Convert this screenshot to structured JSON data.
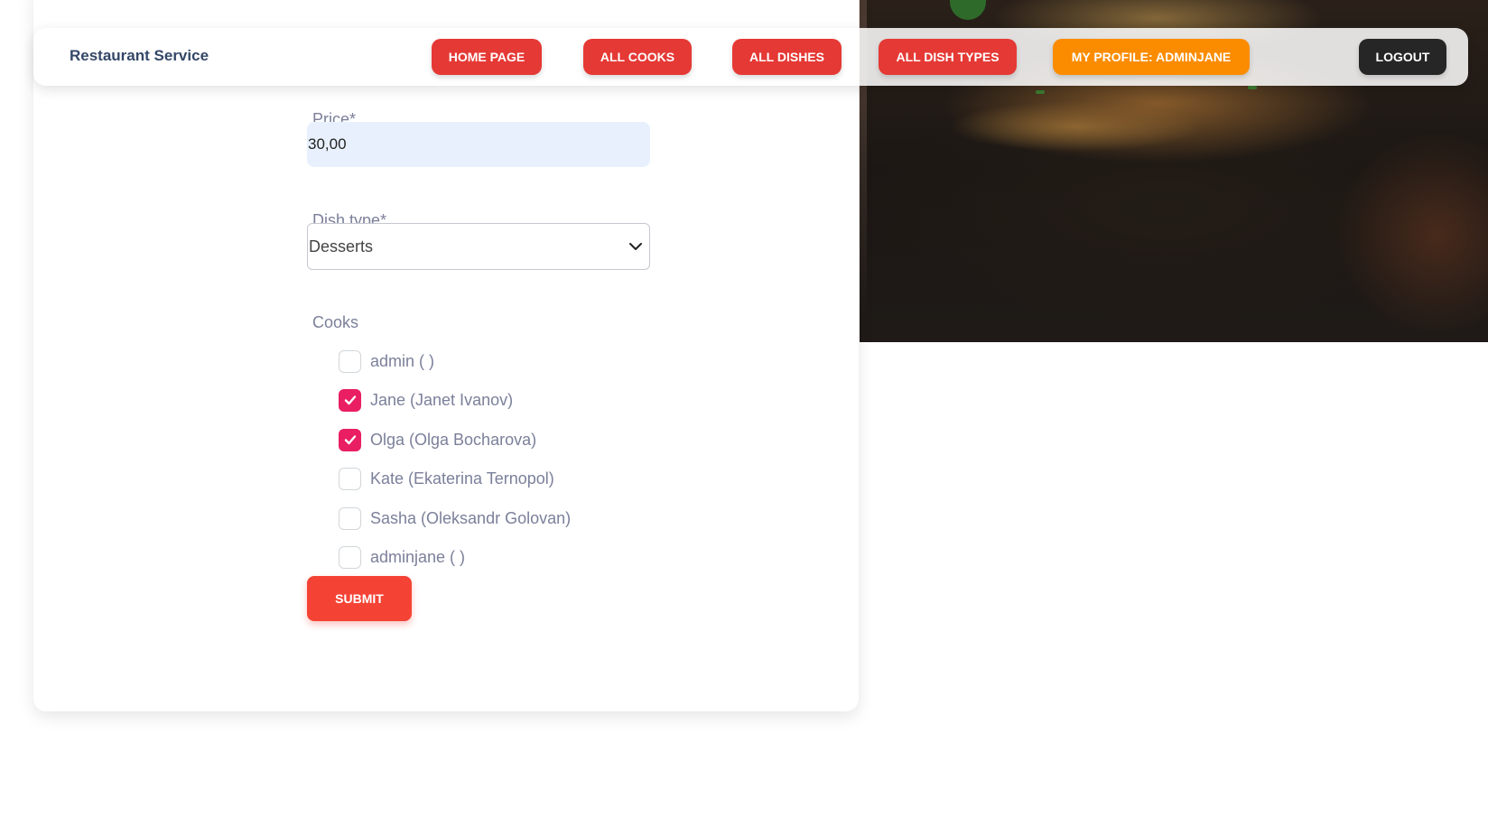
{
  "navbar": {
    "brand": "Restaurant Service",
    "buttons": [
      {
        "label": "HOME PAGE",
        "color": "#e53935"
      },
      {
        "label": "ALL COOKS",
        "color": "#e53935"
      },
      {
        "label": "ALL DISHES",
        "color": "#e53935"
      },
      {
        "label": "ALL DISH TYPES",
        "color": "#e53935"
      },
      {
        "label": "MY PROFILE: ADMINJANE",
        "color": "#fb8c00"
      },
      {
        "label": "LOGOUT",
        "color": "#262626"
      }
    ]
  },
  "form": {
    "price": {
      "label": "Price*",
      "value": "30,00"
    },
    "dish_type": {
      "label": "Dish type*",
      "selected": "Desserts",
      "icon": "chevron-down-icon"
    },
    "cooks": {
      "label": "Cooks",
      "options": [
        {
          "label": "admin ( )",
          "checked": false
        },
        {
          "label": "Jane (Janet Ivanov)",
          "checked": true
        },
        {
          "label": "Olga (Olga Bocharova)",
          "checked": true
        },
        {
          "label": "Kate (Ekaterina Ternopol)",
          "checked": false
        },
        {
          "label": "Sasha (Oleksandr Golovan)",
          "checked": false
        },
        {
          "label": "adminjane ( )",
          "checked": false
        }
      ]
    },
    "submit_label": "SUBMIT"
  },
  "colors": {
    "accent_checkbox": "#e91e63",
    "submit": "#f44335",
    "input_bg": "#e8f0fe"
  }
}
